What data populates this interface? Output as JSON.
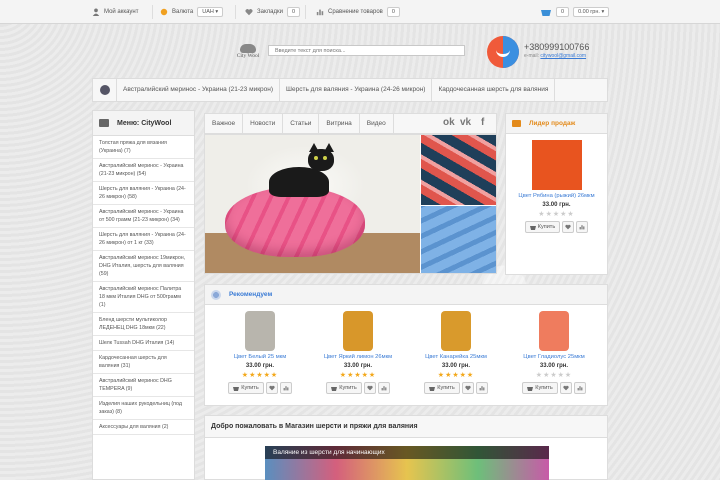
{
  "topbar": {
    "account": "Мой аккаунт",
    "currency_label": "Валюта",
    "currency_value": "UAH",
    "bookmarks_label": "Закладки",
    "bookmarks_count": "0",
    "compare_label": "Сравнение товаров",
    "compare_count": "0",
    "cart_count": "0",
    "cart_total": "0.00 грн."
  },
  "header": {
    "logo_text": "City Wool",
    "search_placeholder": "Введите текст для поиска...",
    "phone": "+380999100766",
    "email_label": "e-mail:",
    "email": "citywool@gmail.com"
  },
  "categories": [
    "Австралийский меринос - Украина (21-23 микрон)",
    "Шерсть для валяния - Украина (24-26 микрон)",
    "Кардочесанная шерсть для валяния"
  ],
  "sidebar": {
    "title": "Меню: CityWool",
    "items": [
      "Толстая пряжа для вязания (Украина) (7)",
      "Австралийский меринос - Украина (21-23 микрон) (54)",
      "Шерсть для валяния - Украина (24-26 микрон) (58)",
      "Австралийский меринос - Украина от 500 грамм (21-23 микрон) (34)",
      "Шерсть для валяния - Украина (24-26 микрон) от 1 кг (33)",
      "Австралийский меринос 19микрон, DHG Италия, шерсть для валяния (59)",
      "Австралийский меринос Палитра 18 мкм Италия DHG от 500грамм (1)",
      "Бленд шерсти мультиколор ЛЕДЕНЕЦ DHG 18мкм (22)",
      "Шелк Tussah DHG Италия (14)",
      "Кардочесанная шерсть для валяния (31)",
      "Австралийский меринос DHG TEMPERA (9)",
      "Изделия наших рукодельниц (под заказ) (8)",
      "Аксессуары для валяния (2)"
    ]
  },
  "tabs": [
    "Важное",
    "Новости",
    "Статьи",
    "Витрина",
    "Видео"
  ],
  "social": {
    "ok": "ok",
    "vk": "vk",
    "fb": "f"
  },
  "bestseller": {
    "title": "Лидер продаж",
    "product": {
      "name": "Цвет Рябина (рыжий) 26мкм",
      "price": "33.00 грн.",
      "color": "#e8541f"
    }
  },
  "recommended": {
    "title": "Рекомендуем",
    "products": [
      {
        "name": "Цвет Белый 25 мкм",
        "price": "33.00 грн.",
        "color": "#b8b5ad",
        "rated": true
      },
      {
        "name": "Цвет Яркий лимон 26мкм",
        "price": "33.00 грн.",
        "color": "#d8972a",
        "rated": true
      },
      {
        "name": "Цвет Канарейка 25мкм",
        "price": "33.00 грн.",
        "color": "#d99a2c",
        "rated": true
      },
      {
        "name": "Цвет Гладиолус 25мкм",
        "price": "33.00 грн.",
        "color": "#ef7c5e",
        "rated": false
      }
    ]
  },
  "buttons": {
    "buy": "Купить"
  },
  "welcome": {
    "title": "Добро пожаловать в Магазин шерсти и пряжи для валяния",
    "video_title": "Валяние из шерсти для начинающих"
  }
}
